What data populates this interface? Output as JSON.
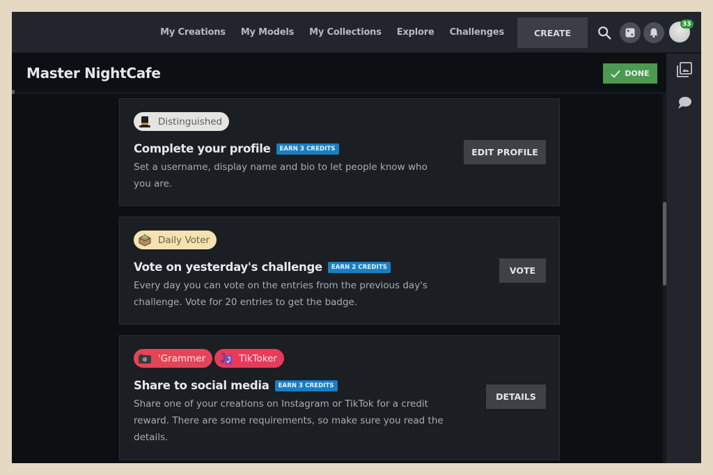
{
  "nav": {
    "links": [
      "My Creations",
      "My Models",
      "My Collections",
      "Explore",
      "Challenges"
    ],
    "create_label": "CREATE",
    "notification_count": "33"
  },
  "header": {
    "title": "Master NightCafe",
    "done_label": "DONE"
  },
  "colors": {
    "accent_green": "#4c9a52",
    "credits_blue": "#1a7fc2",
    "nav_bg": "#22252b",
    "card_bg": "#1b1e22"
  },
  "cards": [
    {
      "badges": [
        {
          "label": "Distinguished",
          "icon": "top-hat-icon"
        }
      ],
      "title": "Complete your profile",
      "credits": "EARN 3 CREDITS",
      "description": "Set a username, display name and bio to let people know who you are.",
      "button": "EDIT PROFILE"
    },
    {
      "badges": [
        {
          "label": "Daily Voter",
          "icon": "ballot-box-icon"
        }
      ],
      "title": "Vote on yesterday's challenge",
      "credits": "EARN 2 CREDITS",
      "description": "Every day you can vote on the entries from the previous day's challenge. Vote for 20 entries to get the badge.",
      "button": "VOTE"
    },
    {
      "badges": [
        {
          "label": "'Grammer",
          "icon": "camera-icon"
        },
        {
          "label": "TikToker",
          "icon": "music-notes-icon"
        }
      ],
      "title": "Share to social media",
      "credits": "EARN 3 CREDITS",
      "description": "Share one of your creations on Instagram or TikTok for a credit reward. There are some requirements, so make sure you read the details.",
      "button": "DETAILS"
    }
  ]
}
